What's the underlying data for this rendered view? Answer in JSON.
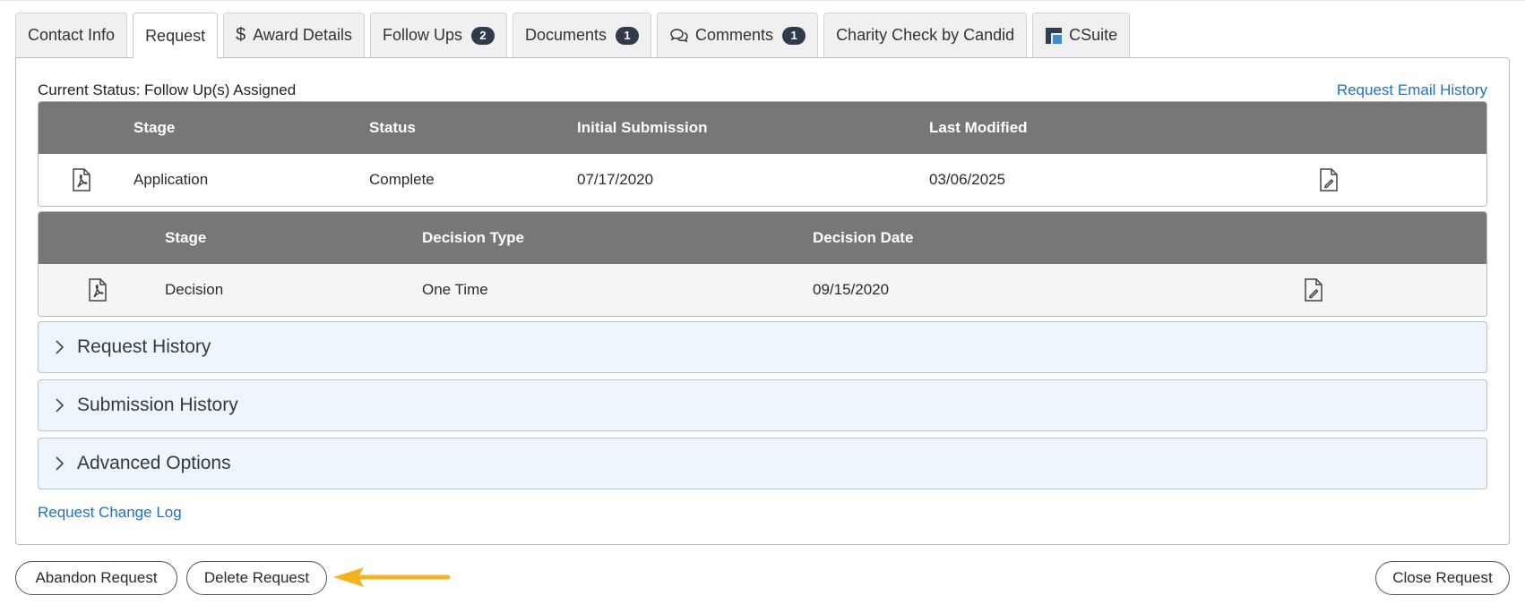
{
  "tabs": [
    {
      "label": "Contact Info"
    },
    {
      "label": "Request"
    },
    {
      "label": "Award Details",
      "icon": "dollar-icon"
    },
    {
      "label": "Follow Ups",
      "badge": "2"
    },
    {
      "label": "Documents",
      "badge": "1"
    },
    {
      "label": "Comments",
      "badge": "1",
      "icon": "comments-icon"
    },
    {
      "label": "Charity Check by Candid"
    },
    {
      "label": "CSuite",
      "icon": "csuite-logo-icon"
    }
  ],
  "status": {
    "text": "Current Status: Follow Up(s) Assigned"
  },
  "links": {
    "email_history": "Request Email History",
    "change_log": "Request Change Log"
  },
  "application_table": {
    "headers": [
      "Stage",
      "Status",
      "Initial Submission",
      "Last Modified"
    ],
    "rows": [
      {
        "stage": "Application",
        "status": "Complete",
        "initial_submission": "07/17/2020",
        "last_modified": "03/06/2025"
      }
    ]
  },
  "decision_table": {
    "headers": [
      "Stage",
      "Decision Type",
      "Decision Date"
    ],
    "rows": [
      {
        "stage": "Decision",
        "decision_type": "One Time",
        "decision_date": "09/15/2020"
      }
    ]
  },
  "accordions": [
    {
      "label": "Request History"
    },
    {
      "label": "Submission History"
    },
    {
      "label": "Advanced Options"
    }
  ],
  "buttons": {
    "abandon": "Abandon Request",
    "delete": "Delete Request",
    "close": "Close Request"
  },
  "colors": {
    "link": "#1a73c8",
    "table_header": "#777777",
    "accordion_bg": "#eef5fd",
    "badge": "#2f3b4a",
    "annotation_arrow": "#f5b321"
  }
}
